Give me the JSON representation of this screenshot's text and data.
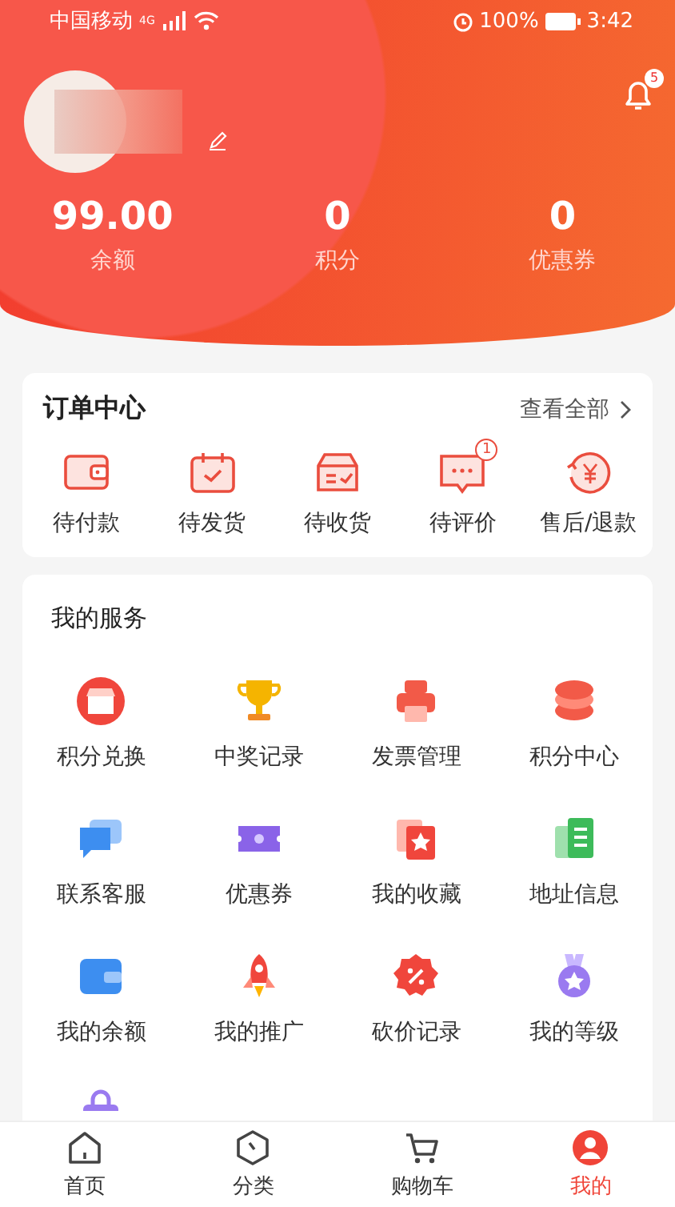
{
  "status_bar": {
    "carrier": "中国移动",
    "network": "4G",
    "battery": "100%",
    "time": "3:42"
  },
  "profile": {
    "notifications": "5"
  },
  "stats": [
    {
      "value": "99.00",
      "label": "余额"
    },
    {
      "value": "0",
      "label": "积分"
    },
    {
      "value": "0",
      "label": "优惠券"
    }
  ],
  "orders": {
    "title": "订单中心",
    "view_all": "查看全部",
    "items": [
      {
        "kind": "wallet",
        "label": "待付款"
      },
      {
        "kind": "calendar",
        "label": "待发货"
      },
      {
        "kind": "box",
        "label": "待收货"
      },
      {
        "kind": "chat",
        "label": "待评价",
        "badge": "1"
      },
      {
        "kind": "refund",
        "label": "售后/退款"
      }
    ]
  },
  "services": {
    "title": "我的服务",
    "items": [
      {
        "kind": "store",
        "label": "积分兑换",
        "color": "#f0463c"
      },
      {
        "kind": "trophy",
        "label": "中奖记录",
        "color": "#f5b400"
      },
      {
        "kind": "printer",
        "label": "发票管理",
        "color": "#f25a48"
      },
      {
        "kind": "stack",
        "label": "积分中心",
        "color": "#f25a48"
      },
      {
        "kind": "chat",
        "label": "联系客服",
        "color": "#3d8ef0"
      },
      {
        "kind": "ticket",
        "label": "优惠券",
        "color": "#8a63e8"
      },
      {
        "kind": "star",
        "label": "我的收藏",
        "color": "#f0463c"
      },
      {
        "kind": "document",
        "label": "地址信息",
        "color": "#3dbb5a"
      },
      {
        "kind": "wallet",
        "label": "我的余额",
        "color": "#3d8ef0"
      },
      {
        "kind": "rocket",
        "label": "我的推广",
        "color": "#f0463c"
      },
      {
        "kind": "percent",
        "label": "砍价记录",
        "color": "#f0463c"
      },
      {
        "kind": "medal",
        "label": "我的等级",
        "color": "#9a7af0"
      },
      {
        "kind": "bag",
        "color": "#9a7af0"
      }
    ]
  },
  "tab_bar": [
    {
      "kind": "home",
      "label": "首页",
      "selected": false
    },
    {
      "kind": "category",
      "label": "分类",
      "selected": false
    },
    {
      "kind": "cart",
      "label": "购物车",
      "selected": false
    },
    {
      "kind": "profile",
      "label": "我的",
      "selected": true
    }
  ]
}
